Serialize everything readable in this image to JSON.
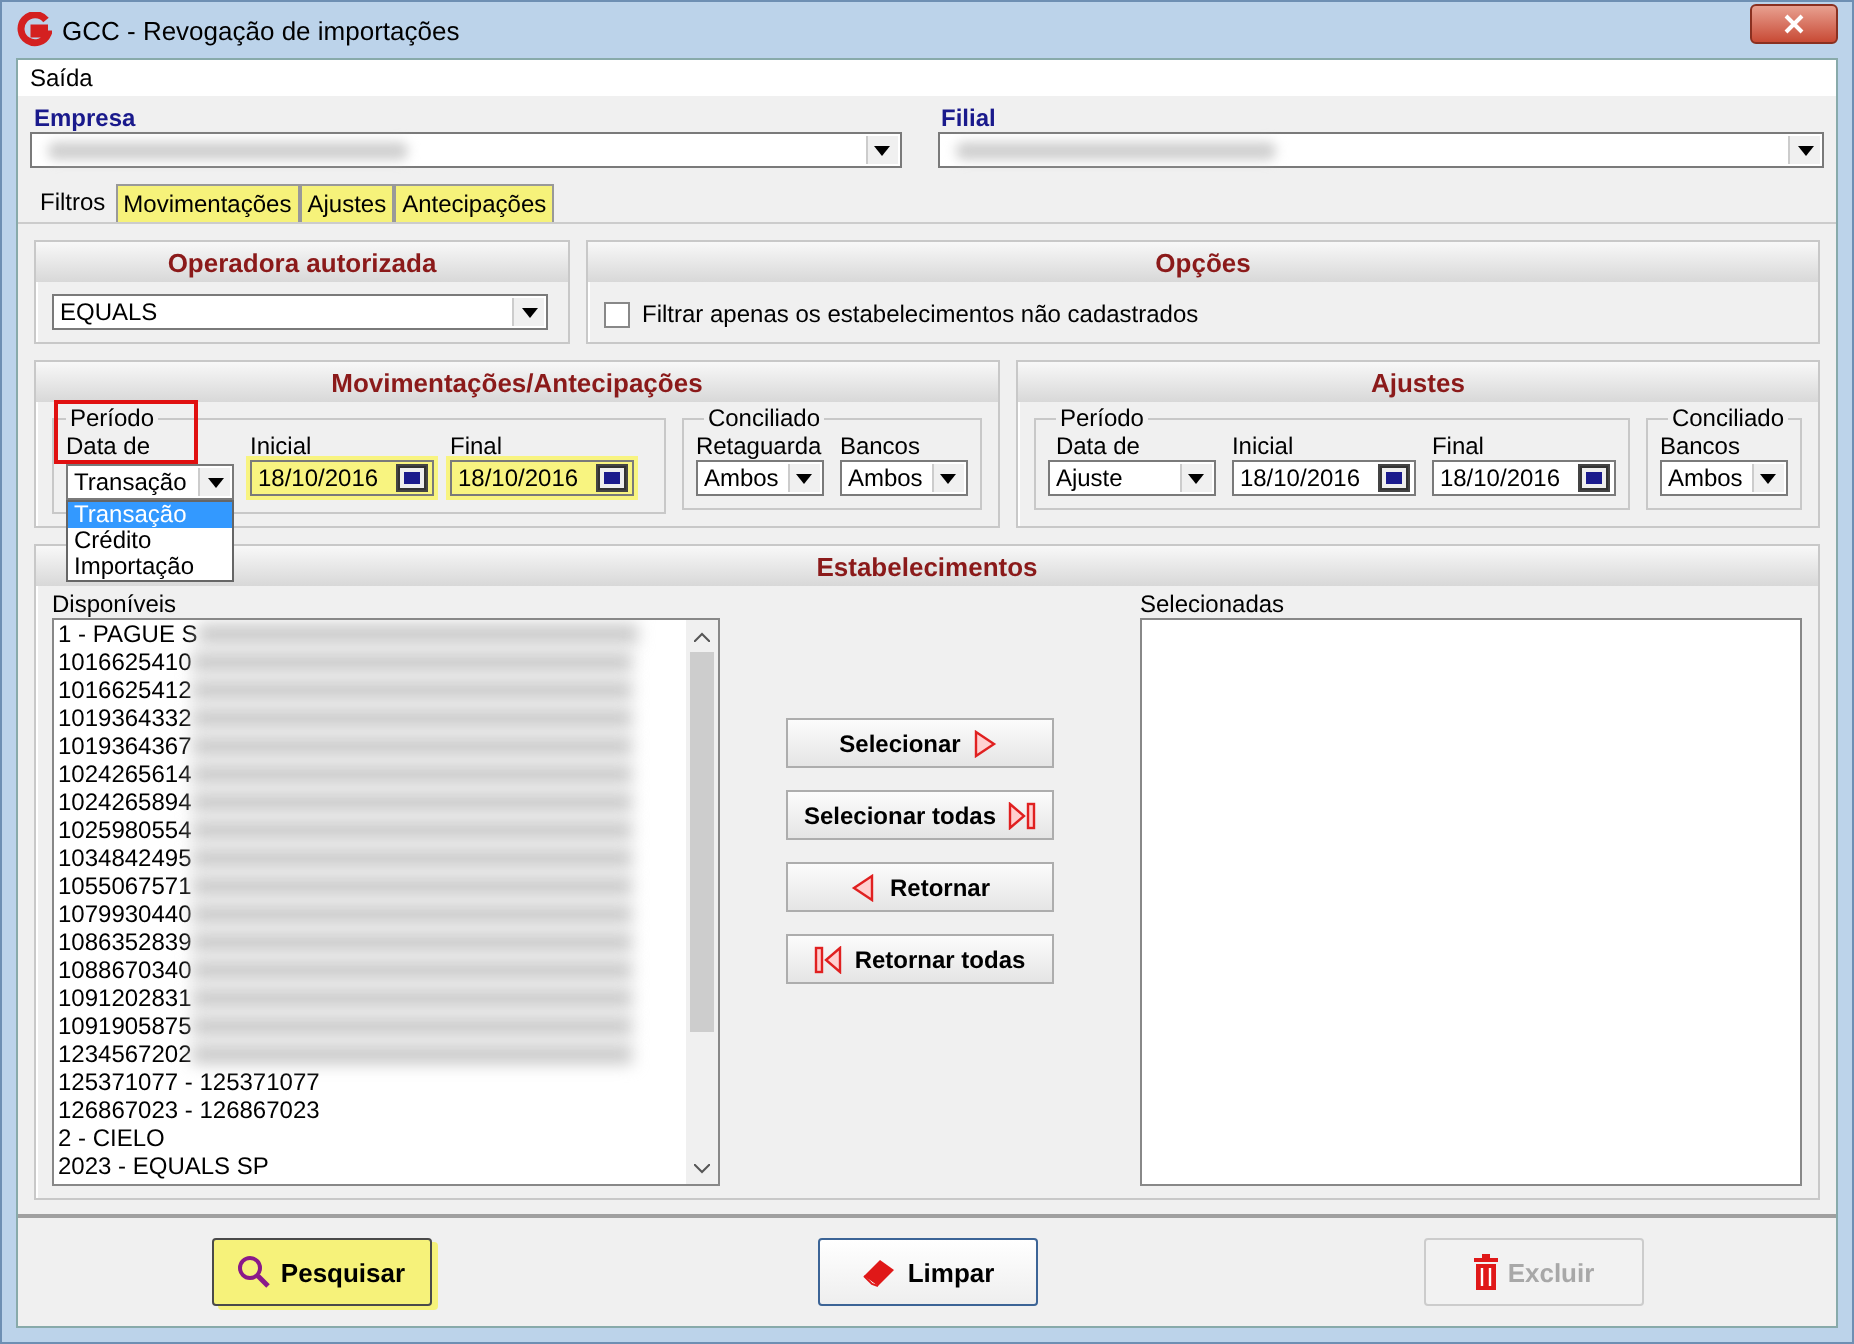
{
  "window": {
    "title": "GCC - Revogação de importações"
  },
  "menu": [
    {
      "label": "Saída"
    }
  ],
  "empresa": {
    "label": "Empresa"
  },
  "filial": {
    "label": "Filial"
  },
  "tabs": [
    {
      "label": "Filtros",
      "selected": true,
      "highlighted": false
    },
    {
      "label": "Movimentações",
      "selected": false,
      "highlighted": true
    },
    {
      "label": "Ajustes",
      "selected": false,
      "highlighted": true
    },
    {
      "label": "Antecipações",
      "selected": false,
      "highlighted": true
    }
  ],
  "operadora": {
    "title": "Operadora autorizada",
    "value": "EQUALS"
  },
  "opcoes": {
    "title": "Opções",
    "checkbox": {
      "label": "Filtrar apenas os estabelecimentos não cadastrados",
      "checked": false
    }
  },
  "movimentacoes": {
    "title": "Movimentações/Antecipações",
    "periodo": {
      "annotated": true,
      "legend": "Período",
      "data_de": {
        "label": "Data de",
        "value": "Transação",
        "options": [
          {
            "label": "Transação",
            "selected": true
          },
          {
            "label": "Crédito",
            "selected": false
          },
          {
            "label": "Importação",
            "selected": false
          }
        ]
      },
      "dates": [
        {
          "label": "Inicial",
          "value": "18/10/2016",
          "highlighted": true
        },
        {
          "label": "Final",
          "value": "18/10/2016",
          "highlighted": true
        }
      ]
    },
    "conciliado": {
      "legend": "Conciliado",
      "fields": [
        {
          "label": "Retaguarda",
          "value": "Ambos"
        },
        {
          "label": "Bancos",
          "value": "Ambos"
        }
      ]
    }
  },
  "ajustes": {
    "title": "Ajustes",
    "periodo": {
      "annotated": false,
      "legend": "Período",
      "data_de": {
        "label": "Data de",
        "value": "Ajuste"
      },
      "dates": [
        {
          "label": "Inicial",
          "value": "18/10/2016",
          "highlighted": false
        },
        {
          "label": "Final",
          "value": "18/10/2016",
          "highlighted": false
        }
      ]
    },
    "conciliado": {
      "legend": "Conciliado",
      "fields": [
        {
          "label": "Bancos",
          "value": "Ambos"
        }
      ]
    }
  },
  "estabelecimentos": {
    "title": "Estabelecimentos",
    "available": {
      "label": "Disponíveis",
      "items": [
        {
          "text": "1 - PAGUE S",
          "blurred": true
        },
        {
          "text": "1016625410",
          "blurred": true
        },
        {
          "text": "1016625412",
          "blurred": true
        },
        {
          "text": "1019364332",
          "blurred": true
        },
        {
          "text": "1019364367",
          "blurred": true
        },
        {
          "text": "1024265614",
          "blurred": true
        },
        {
          "text": "1024265894",
          "blurred": true
        },
        {
          "text": "1025980554",
          "blurred": true
        },
        {
          "text": "1034842495",
          "blurred": true
        },
        {
          "text": "1055067571",
          "blurred": true
        },
        {
          "text": "1079930440",
          "blurred": true
        },
        {
          "text": "1086352839",
          "blurred": true
        },
        {
          "text": "1088670340",
          "blurred": true
        },
        {
          "text": "1091202831",
          "blurred": true
        },
        {
          "text": "1091905875",
          "blurred": true
        },
        {
          "text": "1234567202",
          "blurred": true
        },
        {
          "text": "125371077 - 125371077",
          "blurred": false
        },
        {
          "text": "126867023 - 126867023",
          "blurred": false
        },
        {
          "text": "2 - CIELO",
          "blurred": false
        },
        {
          "text": "2023 - EQUALS SP",
          "blurred": false
        }
      ]
    },
    "selected_list": {
      "label": "Selecionadas"
    },
    "buttons": [
      {
        "label": "Selecionar",
        "kind": "right"
      },
      {
        "label": "Selecionar todas",
        "kind": "right-end"
      },
      {
        "label": "Retornar",
        "kind": "left"
      },
      {
        "label": "Retornar todas",
        "kind": "left-end"
      }
    ]
  },
  "actions": [
    {
      "label": "Pesquisar",
      "kind": "search",
      "highlighted": true,
      "disabled": false
    },
    {
      "label": "Limpar",
      "kind": "eraser",
      "highlighted": false,
      "disabled": false
    },
    {
      "label": "Excluir",
      "kind": "trash",
      "highlighted": false,
      "disabled": true
    }
  ]
}
